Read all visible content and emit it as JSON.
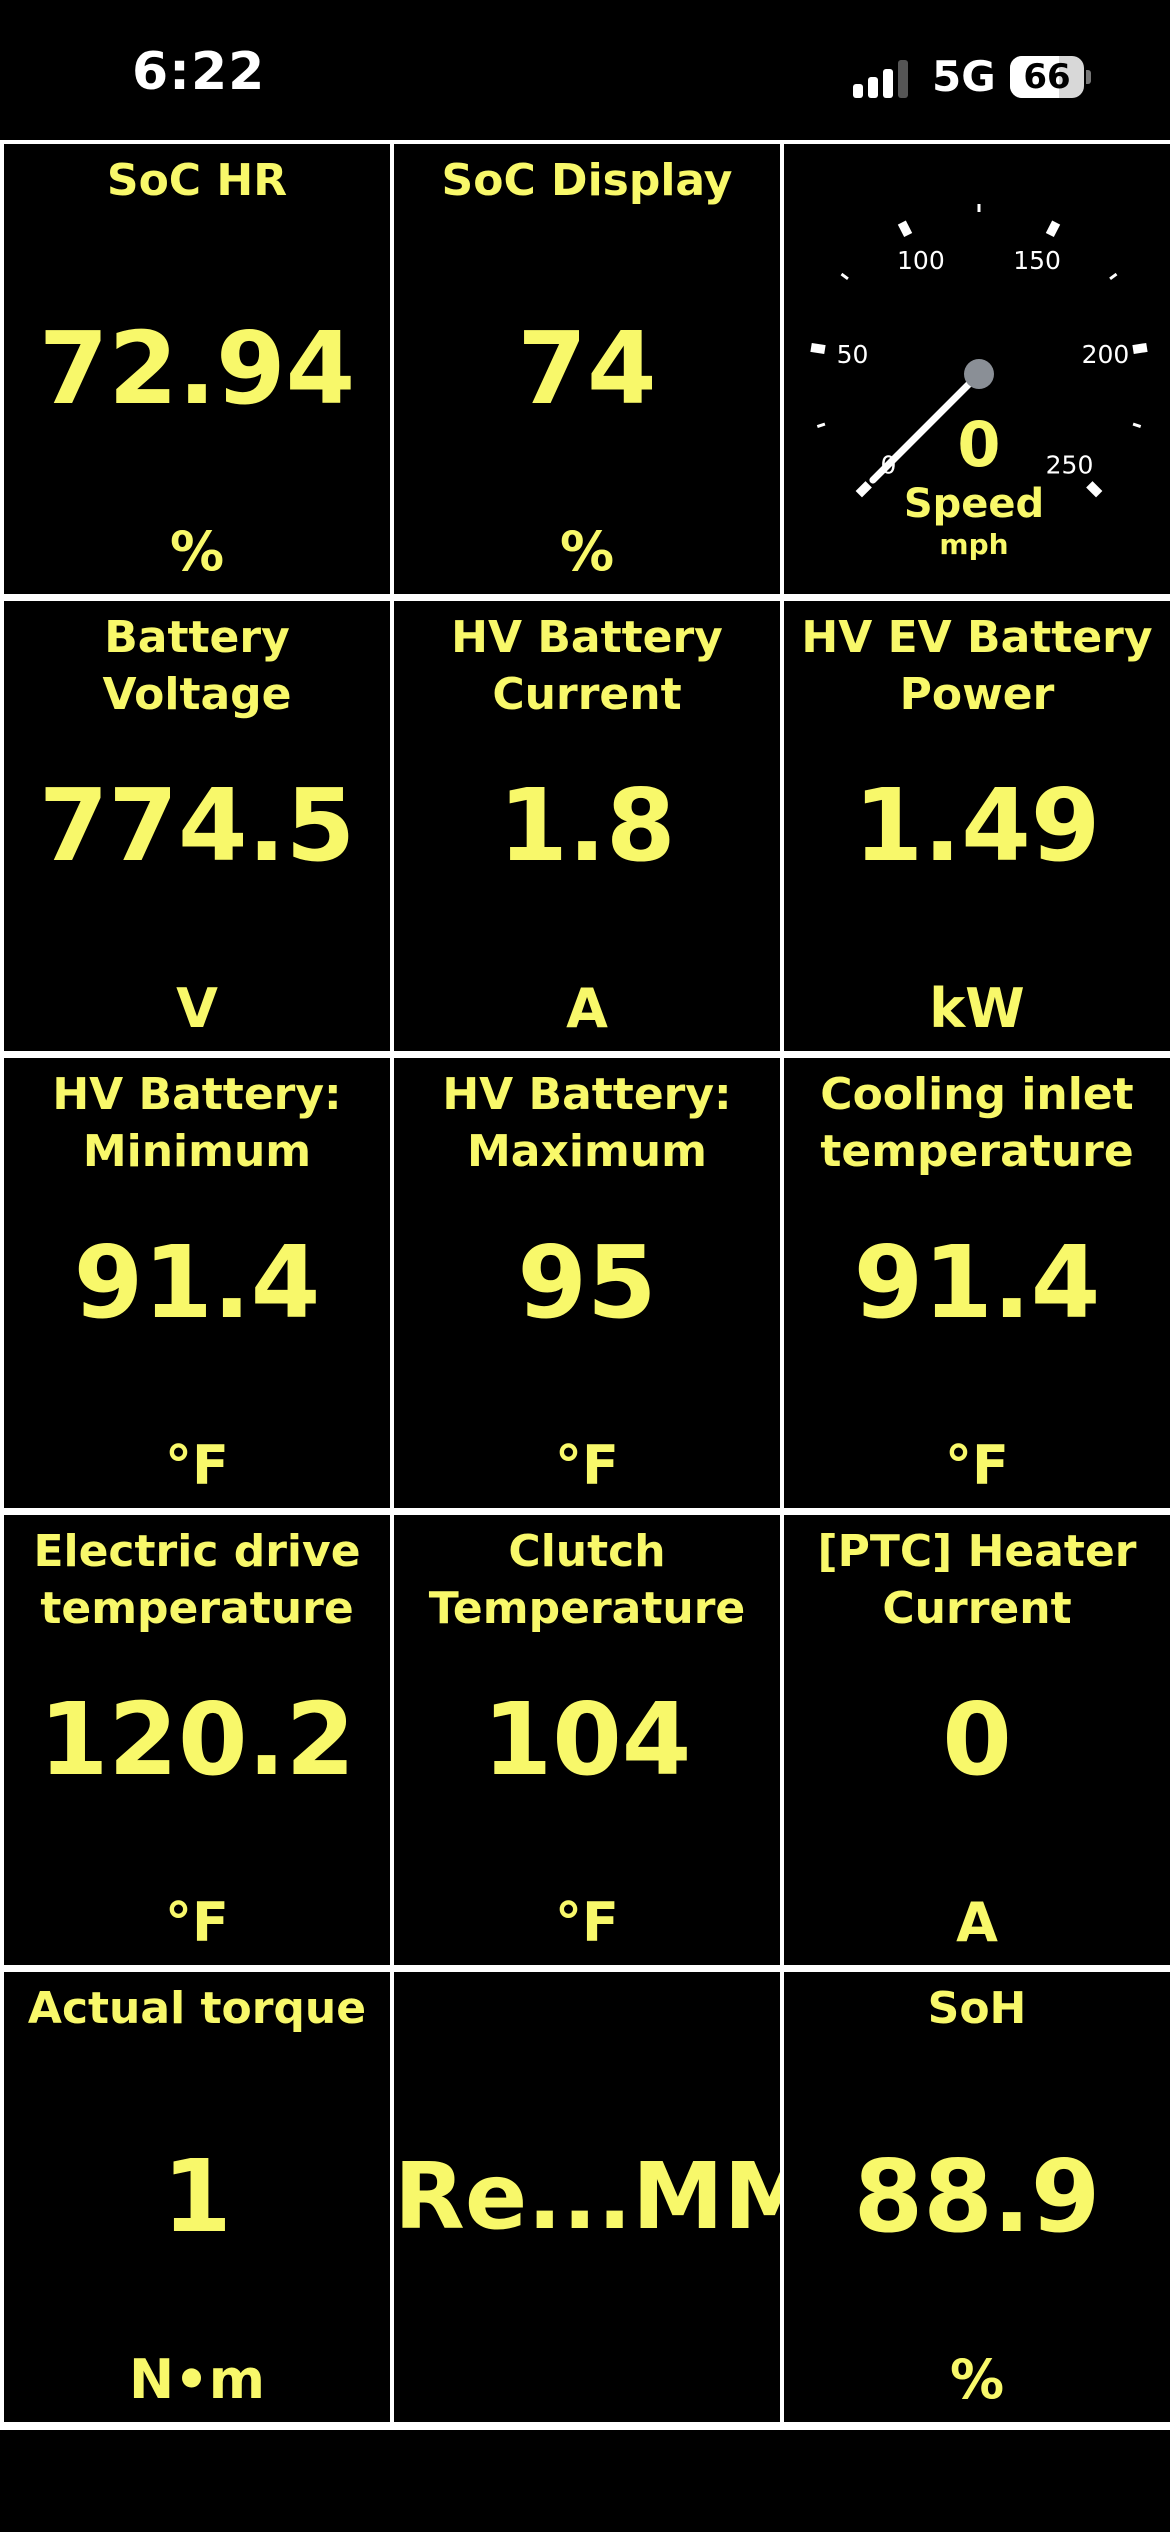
{
  "status_bar": {
    "time": "6:22",
    "network": "5G",
    "battery_percent": "66",
    "battery_level": 0.66,
    "signal_bars": 3
  },
  "colors": {
    "background": "#000000",
    "grid_lines": "#ffffff",
    "tile_text": "#f8f86a",
    "gauge_marks": "#ffffff"
  },
  "speed_gauge": {
    "value": "0",
    "label": "Speed",
    "unit": "mph",
    "tick_labels": [
      "0",
      "50",
      "100",
      "150",
      "200",
      "250"
    ],
    "min": 0,
    "max": 250,
    "current": 0
  },
  "tiles": [
    {
      "label": "SoC HR",
      "value": "72.94",
      "unit": "%"
    },
    {
      "label": "SoC Display",
      "value": "74",
      "unit": "%"
    },
    {
      "label": "Battery Voltage",
      "value": "774.5",
      "unit": "V"
    },
    {
      "label": "HV Battery\nCurrent",
      "value": "1.8",
      "unit": "A"
    },
    {
      "label": "HV EV Battery\nPower",
      "value": "1.49",
      "unit": "kW"
    },
    {
      "label": "HV Battery:\nMinimum",
      "value": "91.4",
      "unit": "°F"
    },
    {
      "label": "HV Battery:\nMaximum",
      "value": "95",
      "unit": "°F"
    },
    {
      "label": "Cooling inlet\ntemperature",
      "value": "91.4",
      "unit": "°F"
    },
    {
      "label": "Electric drive\ntemperature",
      "value": "120.2",
      "unit": "°F"
    },
    {
      "label": "Clutch\nTemperature",
      "value": "104",
      "unit": "°F"
    },
    {
      "label": "[PTC] Heater\nCurrent",
      "value": "0",
      "unit": "A"
    },
    {
      "label": "Actual torque",
      "value": "1",
      "unit": "N•m"
    },
    {
      "label": "",
      "value": "Re...MMI",
      "unit": ""
    },
    {
      "label": "SoH",
      "value": "88.9",
      "unit": "%"
    }
  ]
}
